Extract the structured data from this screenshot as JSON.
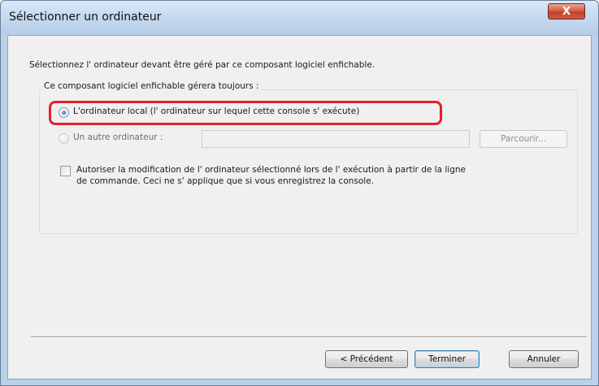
{
  "window": {
    "title": "Sélectionner un ordinateur",
    "close_glyph": "X"
  },
  "instruction": "Sélectionnez l' ordinateur devant être géré par ce composant logiciel enfichable.",
  "group": {
    "label": "Ce composant logiciel enfichable gérera toujours :",
    "options": [
      {
        "label": "L'ordinateur local (l' ordinateur sur lequel cette console s' exécute)",
        "selected": true,
        "enabled": true
      },
      {
        "label": "Un autre ordinateur :",
        "selected": false,
        "enabled": false
      }
    ],
    "computer_name_value": "",
    "browse_label": "Parcourir...",
    "checkbox": {
      "checked": false,
      "line1": "Autoriser la modification de l' ordinateur sélectionné lors de l' exécution à partir de la ligne",
      "line2": "de commande. Ceci ne s' applique que si vous enregistrez la console."
    }
  },
  "buttons": {
    "back": "< Précédent",
    "finish": "Terminer",
    "cancel": "Annuler"
  },
  "colors": {
    "highlight": "#e4202a",
    "close_button": "#c2402a",
    "titlebar": "#c6daf0",
    "dialog_bg": "#f0f0f0"
  }
}
